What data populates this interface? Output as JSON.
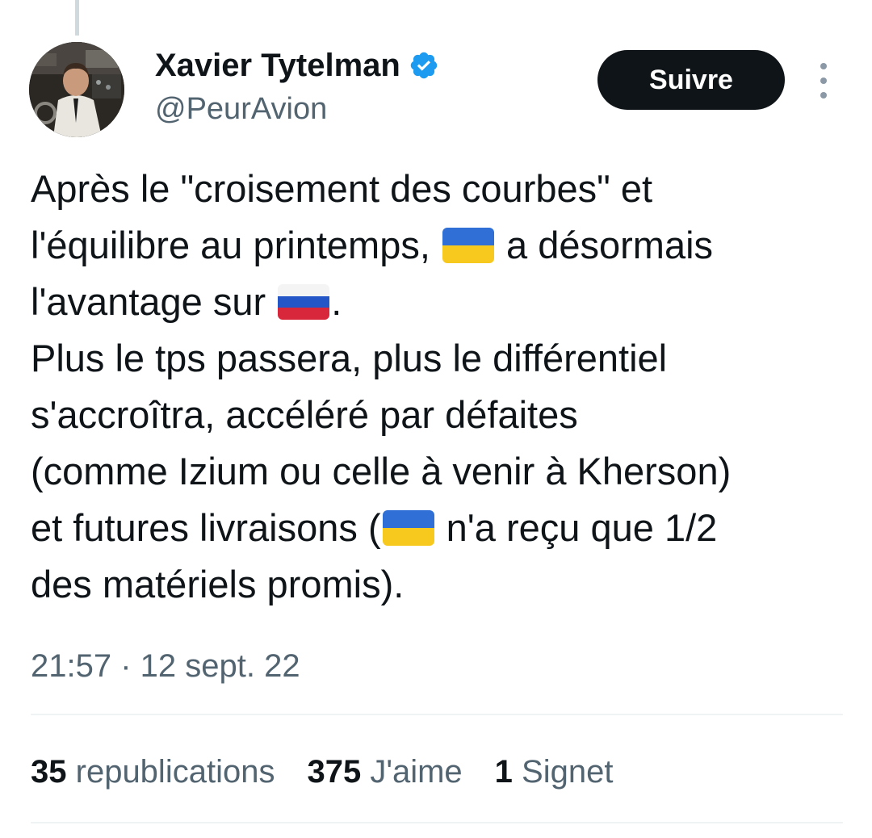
{
  "author": {
    "display_name": "Xavier Tytelman",
    "handle": "@PeurAvion",
    "verified": true
  },
  "header": {
    "follow_label": "Suivre"
  },
  "tweet": {
    "lines": [
      {
        "before": "Après le \"croisement des courbes\" et"
      },
      {
        "before": "l'équilibre au printemps, ",
        "flag": "ukraine",
        "after": " a désormais"
      },
      {
        "before": "l'avantage sur ",
        "flag": "russia",
        "after": "."
      },
      {
        "before": "Plus le tps passera, plus le différentiel"
      },
      {
        "before": "s'accroîtra, accéléré par défaites"
      },
      {
        "before": "(comme Izium ou celle à venir à Kherson)"
      },
      {
        "before": "et futures livraisons (",
        "flag": "ukraine",
        "after": " n'a reçu que 1/2"
      },
      {
        "before": "des matériels promis)."
      }
    ],
    "timestamp": "21:57 · 12 sept. 22"
  },
  "stats": [
    {
      "count": "35",
      "label": "republications"
    },
    {
      "count": "375",
      "label": "J'aime"
    },
    {
      "count": "1",
      "label": "Signet"
    }
  ],
  "colors": {
    "text": "#0f1419",
    "secondary": "#536471",
    "verified": "#1d9bf0",
    "follow_button_bg": "#0f1419",
    "divider": "#eff3f4"
  }
}
